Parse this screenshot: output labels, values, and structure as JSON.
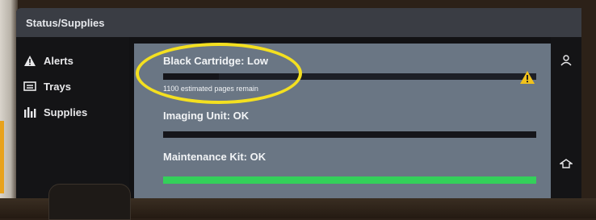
{
  "header": {
    "title": "Status/Supplies"
  },
  "sidebar": {
    "items": [
      {
        "label": "Alerts",
        "icon": "warning-triangle-icon"
      },
      {
        "label": "Trays",
        "icon": "tray-icon"
      },
      {
        "label": "Supplies",
        "icon": "supplies-bars-icon"
      }
    ]
  },
  "supplies": [
    {
      "label": "Black Cartridge: Low",
      "sublabel": "1100 estimated pages remain",
      "level": 0.15,
      "status_icon": "warning-icon",
      "bar_color": "#15151a"
    },
    {
      "label": "Imaging Unit: OK",
      "sublabel": "",
      "level": 1.0,
      "bar_color": "#15151a"
    },
    {
      "label": "Maintenance Kit: OK",
      "sublabel": "",
      "level": 1.0,
      "bar_color": "#34d05a"
    }
  ],
  "right_rail": {
    "icons": [
      "user-icon",
      "home-icon"
    ]
  },
  "colors": {
    "accent_highlight": "#f4e020",
    "warning": "#f2c21b",
    "ok": "#34d05a",
    "panel": "#6a7684"
  }
}
